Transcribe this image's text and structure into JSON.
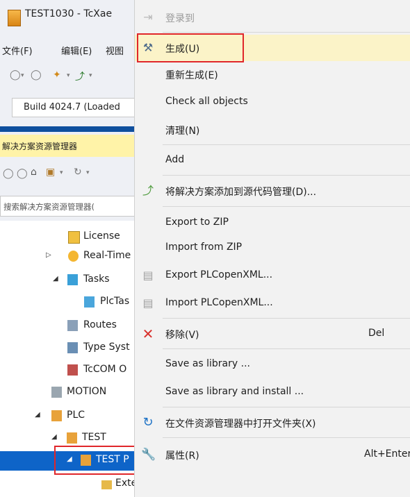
{
  "window": {
    "title": "TEST1030 - TcXae",
    "menubar": [
      "文件(F)",
      "编辑(E)",
      "视图"
    ],
    "build_label": "Build 4024.7 (Loaded",
    "panel_title": "解决方案资源管理器",
    "search_placeholder": "搜索解决方案资源管理器("
  },
  "tree": [
    {
      "label": "License",
      "icon": "license-icon"
    },
    {
      "label": "Real-Time",
      "icon": "realtime-icon"
    },
    {
      "label": "Tasks",
      "icon": "tasks-icon"
    },
    {
      "label": "PlcTas",
      "icon": "task-icon"
    },
    {
      "label": "Routes",
      "icon": "routes-icon"
    },
    {
      "label": "Type Syst",
      "icon": "type-system-icon"
    },
    {
      "label": "TcCOM O",
      "icon": "tccom-icon"
    },
    {
      "label": "MOTION",
      "icon": "motion-icon"
    },
    {
      "label": "PLC",
      "icon": "plc-icon"
    },
    {
      "label": "TEST",
      "icon": "project-icon"
    },
    {
      "label": "TEST P",
      "icon": "plc-project-icon"
    },
    {
      "label": "External Types",
      "icon": "folder-icon"
    }
  ],
  "menu": {
    "items": [
      {
        "label": "登录到",
        "icon": "login-icon",
        "shortcut": ""
      },
      {
        "label": "生成(U)",
        "icon": "build-icon",
        "shortcut": ""
      },
      {
        "label": "重新生成(E)",
        "icon": "",
        "shortcut": ""
      },
      {
        "label": "Check all objects",
        "icon": "",
        "shortcut": ""
      },
      {
        "label": "清理(N)",
        "icon": "",
        "shortcut": ""
      },
      {
        "label": "Add",
        "icon": "",
        "shortcut": ""
      },
      {
        "label": "将解决方案添加到源代码管理(D)...",
        "icon": "source-control-icon",
        "shortcut": ""
      },
      {
        "label": "Export to ZIP",
        "icon": "",
        "shortcut": ""
      },
      {
        "label": "Import from ZIP",
        "icon": "",
        "shortcut": ""
      },
      {
        "label": "Export PLCopenXML...",
        "icon": "export-xml-icon",
        "shortcut": ""
      },
      {
        "label": "Import PLCopenXML...",
        "icon": "import-xml-icon",
        "shortcut": ""
      },
      {
        "label": "移除(V)",
        "icon": "remove-icon",
        "shortcut": "Del"
      },
      {
        "label": "Save as library ...",
        "icon": "",
        "shortcut": ""
      },
      {
        "label": "Save as library and install ...",
        "icon": "",
        "shortcut": ""
      },
      {
        "label": "在文件资源管理器中打开文件夹(X)",
        "icon": "refresh-icon",
        "shortcut": ""
      },
      {
        "label": "属性(R)",
        "icon": "properties-icon",
        "shortcut": "Alt+Enter"
      }
    ]
  },
  "colors": {
    "highlight": "#fbf3c8",
    "selection": "#0e64c8",
    "annotation": "#e0262a",
    "panel_header": "#fff3a8"
  }
}
